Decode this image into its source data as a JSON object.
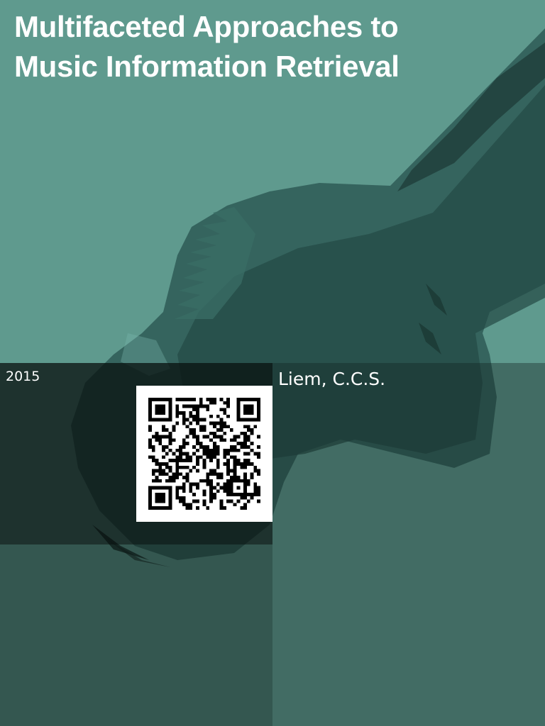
{
  "cover": {
    "title": "Multifaceted Approaches to Music Information Retrieval",
    "year": "2015",
    "author": "Liem, C.C.S."
  },
  "colors": {
    "background": "#5f9a8e",
    "dark_overlay": "#0c1716",
    "text": "#ffffff"
  },
  "icons": {
    "qr_code": "qr-code-icon"
  }
}
